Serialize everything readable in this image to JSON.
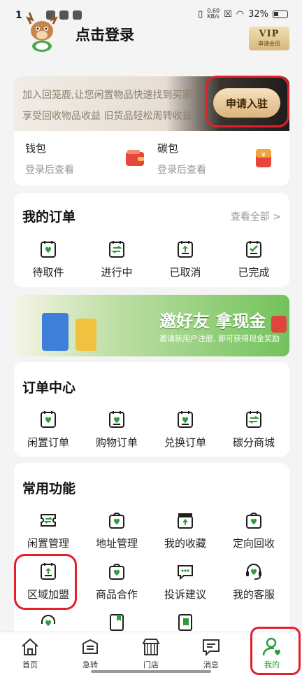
{
  "status_bar": {
    "time": "1",
    "speed_value": "0.60",
    "speed_unit": "KB/s",
    "battery": "32%"
  },
  "header": {
    "login_text": "点击登录",
    "vip_label": "VIP",
    "vip_sub": "申请会员"
  },
  "join": {
    "line1": "加入回笼鹿,让您闲置物品快速找到买家",
    "line2": "享受回收物品收益 旧货品轻松周转收益",
    "button": "申请入驻"
  },
  "wallet": [
    {
      "title": "钱包",
      "sub": "登录后查看",
      "icon": "wallet-icon"
    },
    {
      "title": "碳包",
      "sub": "登录后查看",
      "icon": "red-packet-icon"
    }
  ],
  "my_orders": {
    "title": "我的订单",
    "view_all": "查看全部 >",
    "items": [
      {
        "label": "待取件",
        "icon": "order-pending-icon"
      },
      {
        "label": "进行中",
        "icon": "order-progress-icon"
      },
      {
        "label": "已取消",
        "icon": "order-cancel-icon"
      },
      {
        "label": "已完成",
        "icon": "order-done-icon"
      }
    ]
  },
  "banner": {
    "title": "邀好友 拿现金",
    "sub": "邀请新用户注册, 即可获得现金奖励"
  },
  "order_center": {
    "title": "订单中心",
    "items": [
      {
        "label": "闲置订单",
        "icon": "idle-order-icon"
      },
      {
        "label": "购物订单",
        "icon": "shopping-order-icon"
      },
      {
        "label": "兑换订单",
        "icon": "exchange-order-icon"
      },
      {
        "label": "碳分商城",
        "icon": "carbon-mall-icon"
      }
    ]
  },
  "functions": {
    "title": "常用功能",
    "items": [
      {
        "label": "闲置管理",
        "icon": "idle-manage-icon"
      },
      {
        "label": "地址管理",
        "icon": "address-icon"
      },
      {
        "label": "我的收藏",
        "icon": "favorites-icon"
      },
      {
        "label": "定向回收",
        "icon": "directed-recycle-icon"
      },
      {
        "label": "区域加盟",
        "icon": "region-join-icon"
      },
      {
        "label": "商品合作",
        "icon": "cooperation-icon"
      },
      {
        "label": "投诉建议",
        "icon": "feedback-icon"
      },
      {
        "label": "我的客服",
        "icon": "customer-service-icon"
      }
    ]
  },
  "nav": [
    {
      "label": "首页",
      "icon": "home-icon"
    },
    {
      "label": "急转",
      "icon": "quick-sell-icon"
    },
    {
      "label": "门店",
      "icon": "store-icon"
    },
    {
      "label": "消息",
      "icon": "message-icon"
    },
    {
      "label": "我的",
      "icon": "profile-icon"
    }
  ],
  "colors": {
    "accent": "#2e9b3c",
    "highlight": "#e0202a",
    "icon_stroke": "#1f1f1f"
  }
}
